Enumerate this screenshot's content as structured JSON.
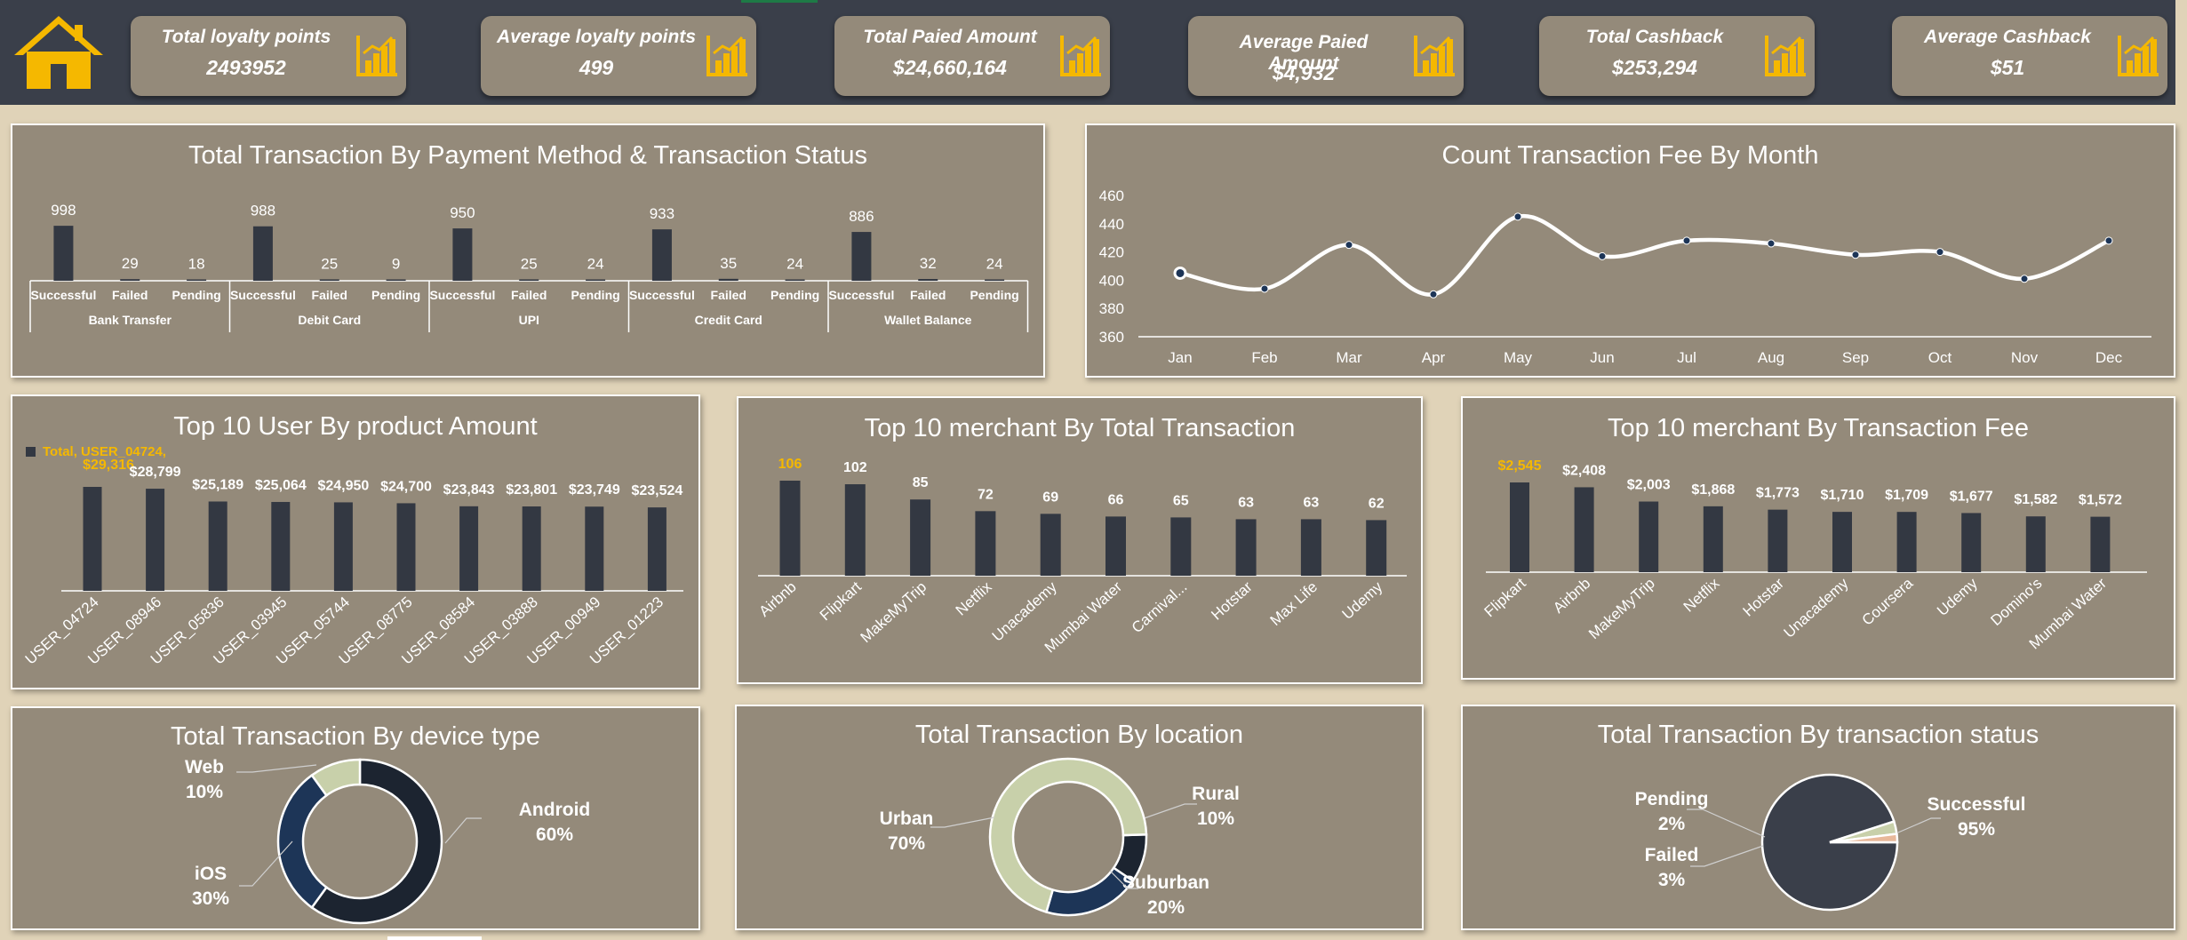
{
  "colors": {
    "header_bg": "#3a3f4a",
    "panel_bg": "#948a7a",
    "page_bg": "#e0d3b8",
    "bar": "#333842",
    "highlight": "#f5b800",
    "navy": "#1d3557",
    "sage": "#c8d0aa",
    "dark": "#1c2430"
  },
  "header": {
    "home_icon": "home-icon",
    "kpis": [
      {
        "title": "Total loyalty points",
        "value": "2493952",
        "icon": "bar-chart-icon"
      },
      {
        "title": "Average loyalty points",
        "value": "499",
        "icon": "bar-chart-icon"
      },
      {
        "title": "Total  Paied Amount",
        "value": "$24,660,164",
        "icon": "bar-chart-icon"
      },
      {
        "title": "Average  Paied Amount",
        "value": "$4,932",
        "icon": "bar-chart-icon"
      },
      {
        "title": "Total Cashback",
        "value": "$253,294",
        "icon": "bar-chart-icon"
      },
      {
        "title": "Average Cashback",
        "value": "$51",
        "icon": "bar-chart-icon"
      }
    ]
  },
  "chart_data": [
    {
      "type": "bar",
      "title": "Total Transaction By Payment Method & Transaction Status",
      "groups": [
        {
          "name": "Bank Transfer",
          "categories": [
            "Successful",
            "Failed",
            "Pending"
          ],
          "values": [
            998,
            29,
            18
          ]
        },
        {
          "name": "Debit Card",
          "categories": [
            "Successful",
            "Failed",
            "Pending"
          ],
          "values": [
            988,
            25,
            9
          ]
        },
        {
          "name": "UPI",
          "categories": [
            "Successful",
            "Failed",
            "Pending"
          ],
          "values": [
            950,
            25,
            24
          ]
        },
        {
          "name": "Credit Card",
          "categories": [
            "Successful",
            "Failed",
            "Pending"
          ],
          "values": [
            933,
            35,
            24
          ]
        },
        {
          "name": "Wallet Balance",
          "categories": [
            "Successful",
            "Failed",
            "Pending"
          ],
          "values": [
            886,
            32,
            24
          ]
        }
      ],
      "expand_label": "+",
      "collapse_label": "−"
    },
    {
      "type": "line",
      "title": "Count Transaction Fee By Month",
      "categories": [
        "Jan",
        "Feb",
        "Mar",
        "Apr",
        "May",
        "Jun",
        "Jul",
        "Aug",
        "Sep",
        "Oct",
        "Nov",
        "Dec"
      ],
      "values": [
        405,
        394,
        425,
        390,
        445,
        417,
        428,
        426,
        418,
        420,
        401,
        428
      ],
      "ylim": [
        360,
        460
      ],
      "yticks": [
        360,
        380,
        400,
        420,
        440,
        460
      ]
    },
    {
      "type": "bar",
      "title": "Top 10  User By product Amount",
      "categories": [
        "USER_04724",
        "USER_08946",
        "USER_05836",
        "USER_03945",
        "USER_05744",
        "USER_08775",
        "USER_08584",
        "USER_03888",
        "USER_00949",
        "USER_01223"
      ],
      "values": [
        29316,
        28799,
        25189,
        25064,
        24950,
        24700,
        23843,
        23801,
        23749,
        23524
      ],
      "labels": [
        "$29,316",
        "$28,799",
        "$25,189",
        "$25,064",
        "$24,950",
        "$24,700",
        "$23,843",
        "$23,801",
        "$23,749",
        "$23,524"
      ],
      "tooltip": "Total, USER_04724,",
      "highlight_index": 0
    },
    {
      "type": "bar",
      "title": "Top 10  merchant By Total Transaction",
      "categories": [
        "Airbnb",
        "Flipkart",
        "MakeMyTrip",
        "Netflix",
        "Unacademy",
        "Mumbai Water",
        "Carnival...",
        "Hotstar",
        "Max Life",
        "Udemy"
      ],
      "values": [
        106,
        102,
        85,
        72,
        69,
        66,
        65,
        63,
        63,
        62
      ],
      "labels": [
        "106",
        "102",
        "85",
        "72",
        "69",
        "66",
        "65",
        "63",
        "63",
        "62"
      ],
      "highlight_index": 0
    },
    {
      "type": "bar",
      "title": "Top 10  merchant By Transaction Fee",
      "categories": [
        "Flipkart",
        "Airbnb",
        "MakeMyTrip",
        "Netflix",
        "Hotstar",
        "Unacademy",
        "Coursera",
        "Udemy",
        "Domino's",
        "Mumbai Water"
      ],
      "values": [
        2545,
        2408,
        2003,
        1868,
        1773,
        1710,
        1709,
        1677,
        1582,
        1572
      ],
      "labels": [
        "$2,545",
        "$2,408",
        "$2,003",
        "$1,868",
        "$1,773",
        "$1,710",
        "$1,709",
        "$1,677",
        "$1,582",
        "$1,572"
      ],
      "highlight_index": 0
    },
    {
      "type": "pie",
      "subtype": "donut",
      "title": "Total Transaction By device type",
      "slices": [
        {
          "name": "Android",
          "value": 60,
          "label": "60%",
          "color": "#1c2430"
        },
        {
          "name": "iOS",
          "value": 30,
          "label": "30%",
          "color": "#1d3557"
        },
        {
          "name": "Web",
          "value": 10,
          "label": "10%",
          "color": "#c8d0aa"
        }
      ]
    },
    {
      "type": "pie",
      "subtype": "donut",
      "title": "Total Transaction By location",
      "slices": [
        {
          "name": "Rural",
          "value": 10,
          "label": "10%",
          "color": "#1c2430"
        },
        {
          "name": "Suburban",
          "value": 20,
          "label": "20%",
          "color": "#1d3557"
        },
        {
          "name": "Urban",
          "value": 70,
          "label": "70%",
          "color": "#c8d0aa"
        }
      ]
    },
    {
      "type": "pie",
      "title": "Total Transaction By transaction status",
      "slices": [
        {
          "name": "Successful",
          "value": 95,
          "label": "95%",
          "color": "#3a3f4a"
        },
        {
          "name": "Failed",
          "value": 3,
          "label": "3%",
          "color": "#c8d0aa"
        },
        {
          "name": "Pending",
          "value": 2,
          "label": "2%",
          "color": "#e8b89a"
        }
      ]
    }
  ]
}
